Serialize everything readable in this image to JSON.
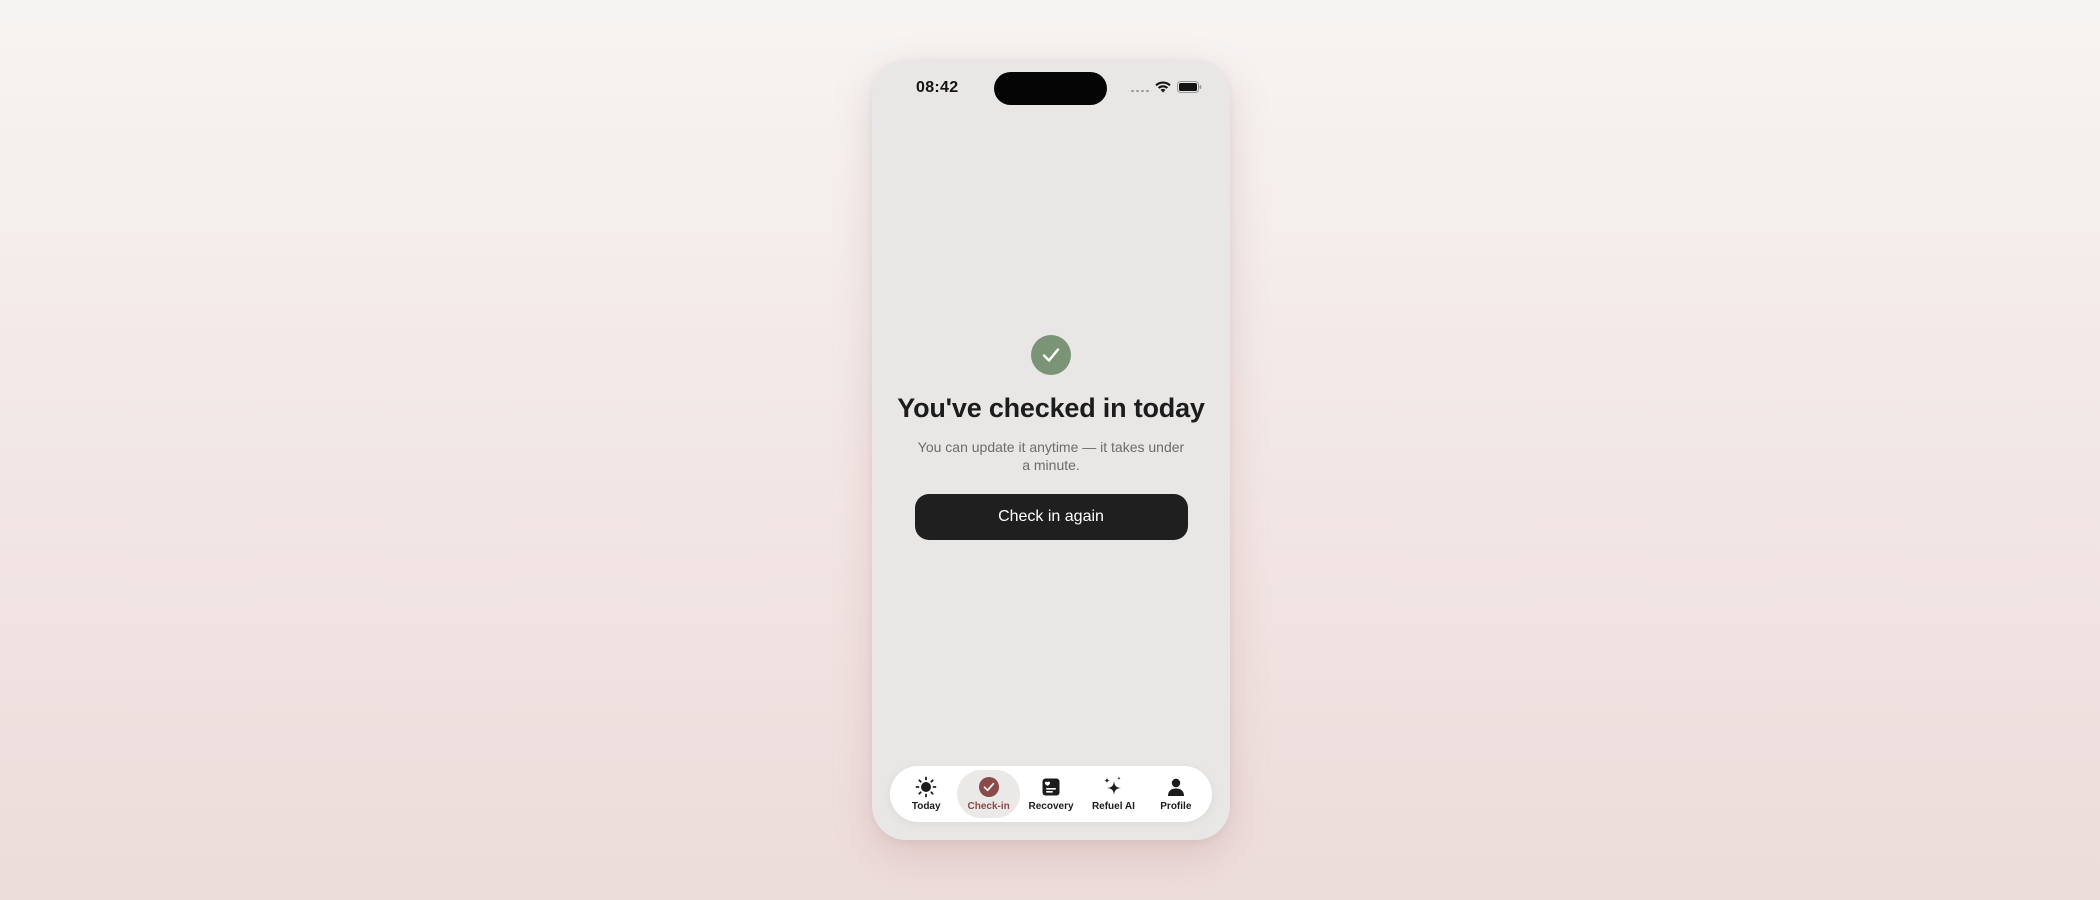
{
  "status_bar": {
    "time": "08:42"
  },
  "checkin": {
    "headline": "You've checked in today",
    "subtext": "You can update it anytime — it takes under a minute.",
    "button_label": "Check in again"
  },
  "tabs": [
    {
      "label": "Today",
      "icon": "sun-icon",
      "active": false
    },
    {
      "label": "Check-in",
      "icon": "check-circle-icon",
      "active": true
    },
    {
      "label": "Recovery",
      "icon": "journal-icon",
      "active": false
    },
    {
      "label": "Refuel AI",
      "icon": "sparkle-icon",
      "active": false
    },
    {
      "label": "Profile",
      "icon": "person-icon",
      "active": false
    }
  ],
  "colors": {
    "accent_green": "#7c9476",
    "active_tab": "#8a4a48",
    "button": "#1f1f1f"
  }
}
